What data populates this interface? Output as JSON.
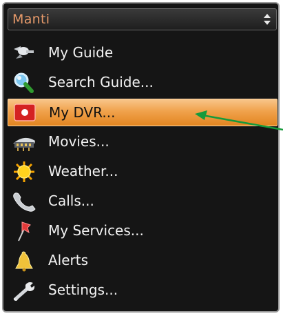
{
  "menu": {
    "header_title": "Manti",
    "header_arrows_icon": "up-down-arrows-icon",
    "selected_index": 2,
    "items": [
      {
        "label": "My Guide",
        "icon": "satellite-icon"
      },
      {
        "label": "Search Guide...",
        "icon": "magnifier-icon"
      },
      {
        "label": "My DVR...",
        "icon": "record-button-icon"
      },
      {
        "label": "Movies...",
        "icon": "film-reel-icon"
      },
      {
        "label": "Weather...",
        "icon": "sun-icon"
      },
      {
        "label": "Calls...",
        "icon": "phone-handset-icon"
      },
      {
        "label": "My Services...",
        "icon": "pushpin-icon"
      },
      {
        "label": "Alerts",
        "icon": "bell-icon"
      },
      {
        "label": "Settings...",
        "icon": "wrench-icon"
      }
    ]
  },
  "annotation": {
    "arrow_color": "#159a3c"
  },
  "colors": {
    "panel_bg": "#151515",
    "header_text": "#e79a6a",
    "highlight": "#f0a24c"
  }
}
